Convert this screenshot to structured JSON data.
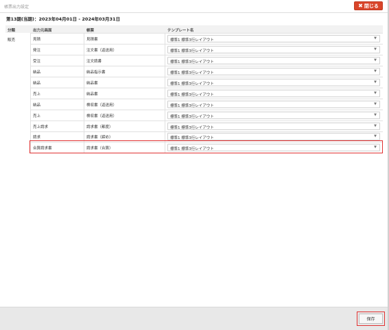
{
  "window": {
    "title": "帳票出力設定",
    "close_label": "閉じる"
  },
  "period": {
    "label": "第13期(当期)：2023年04月01日 - 2024年03月31日"
  },
  "table": {
    "headers": {
      "category": "分類",
      "source": "出力元画面",
      "document": "帳票",
      "template": "テンプレート名"
    },
    "category_label": "販売",
    "rows": [
      {
        "source": "見積",
        "document": "見積書",
        "template": "標準1 標準3行レイアウト"
      },
      {
        "source": "発注",
        "document": "注文書（返送用）",
        "template": "標準1 標準3行レイアウト"
      },
      {
        "source": "受注",
        "document": "注文請書",
        "template": "標準1 標準3行レイアウト"
      },
      {
        "source": "納品",
        "document": "納品指示書",
        "template": "標準1 標準3行レイアウト"
      },
      {
        "source": "納品",
        "document": "納品書",
        "template": "標準1 標準3行レイアウト"
      },
      {
        "source": "売上",
        "document": "納品書",
        "template": "標準1 標準3行レイアウト"
      },
      {
        "source": "納品",
        "document": "検収書（返送用）",
        "template": "標準1 標準3行レイアウト"
      },
      {
        "source": "売上",
        "document": "検収書（返送用）",
        "template": "標準1 標準3行レイアウト"
      },
      {
        "source": "売上請求",
        "document": "請求書（都度）",
        "template": "標準1 標準3行レイアウト"
      },
      {
        "source": "請求",
        "document": "請求書（締め）",
        "template": "標準1 標準3行レイアウト"
      },
      {
        "source": "合算請求書",
        "document": "請求書（合算）",
        "template": "標準1 標準3行レイアウト"
      }
    ]
  },
  "footer": {
    "save_label": "保存"
  },
  "colors": {
    "close_button": "#d9452a",
    "highlight": "#e03030"
  }
}
